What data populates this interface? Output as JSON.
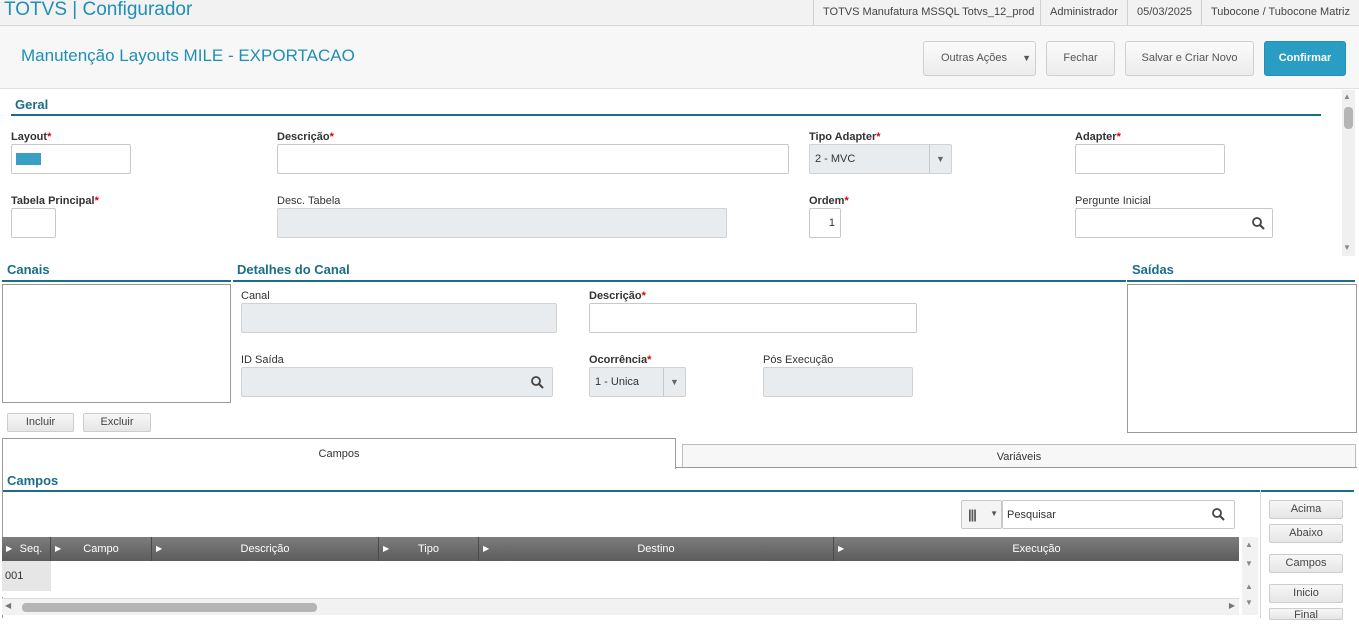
{
  "topbar": {
    "title": "TOTVS | Configurador",
    "environment": "TOTVS Manufatura MSSQL Totvs_12_prod",
    "user": "Administrador",
    "date": "05/03/2025",
    "company": "Tubocone / Tubocone Matriz"
  },
  "header": {
    "title": "Manutenção Layouts MILE - EXPORTACAO",
    "other_actions": "Outras Ações",
    "close": "Fechar",
    "save_new": "Salvar e Criar Novo",
    "confirm": "Confirmar"
  },
  "geral": {
    "section": "Geral",
    "layout_label": "Layout",
    "descricao_label": "Descrição",
    "tipo_adapter_label": "Tipo Adapter",
    "tipo_adapter_value": "2 - MVC",
    "adapter_label": "Adapter",
    "tabela_principal_label": "Tabela Principal",
    "desc_tabela_label": "Desc. Tabela",
    "ordem_label": "Ordem",
    "ordem_value": "1",
    "pergunte_inicial_label": "Pergunte Inicial",
    "required_mark": "*"
  },
  "canais": {
    "section": "Canais",
    "incluir": "Incluir",
    "excluir": "Excluir"
  },
  "detalhes": {
    "section": "Detalhes do Canal",
    "canal_label": "Canal",
    "descricao_label": "Descrição",
    "id_saida_label": "ID Saída",
    "ocorrencia_label": "Ocorrência",
    "ocorrencia_value": "1 - Unica",
    "pos_execucao_label": "Pós Execução"
  },
  "saidas": {
    "section": "Saídas"
  },
  "tabs": {
    "campos": "Campos",
    "variaveis": "Variáveis"
  },
  "campos": {
    "section": "Campos",
    "search_placeholder": "Pesquisar",
    "columns": [
      "Seq.",
      "Campo",
      "Descrição",
      "Tipo",
      "Destino",
      "Execução"
    ],
    "rows": [
      {
        "seq": "001"
      }
    ],
    "side_buttons": [
      "Acima",
      "Abaixo",
      "Campos",
      "Inicio",
      "Final"
    ]
  },
  "colors": {
    "accent": "#1f8fb5",
    "section": "#1a6e87",
    "required": "#dd0000"
  }
}
